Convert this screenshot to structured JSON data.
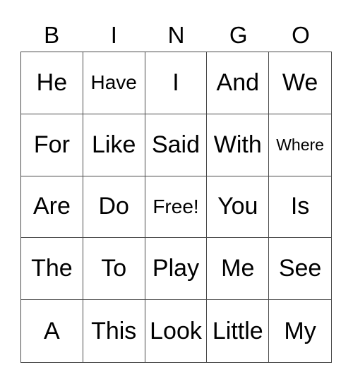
{
  "card": {
    "header": [
      "B",
      "I",
      "N",
      "G",
      "O"
    ],
    "rows": [
      [
        "He",
        "Have",
        "I",
        "And",
        "We"
      ],
      [
        "For",
        "Like",
        "Said",
        "With",
        "Where"
      ],
      [
        "Are",
        "Do",
        "Free!",
        "You",
        "Is"
      ],
      [
        "The",
        "To",
        "Play",
        "Me",
        "See"
      ],
      [
        "A",
        "This",
        "Look",
        "Little",
        "My"
      ]
    ],
    "free_space": "Free!"
  }
}
